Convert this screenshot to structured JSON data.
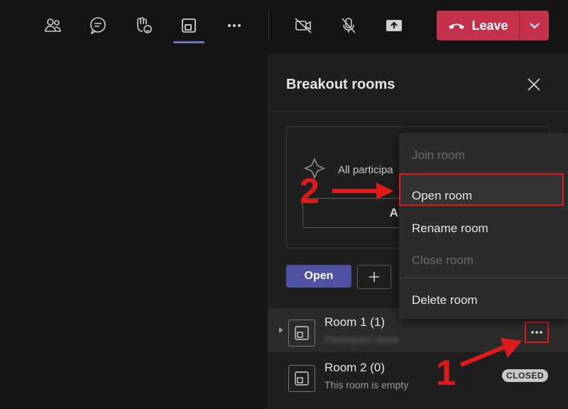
{
  "toolbar": {
    "buttons": [
      {
        "icon": "people-icon"
      },
      {
        "icon": "chat-icon"
      },
      {
        "icon": "reactions-icon"
      },
      {
        "icon": "breakout-rooms-icon"
      },
      {
        "icon": "more-icon"
      },
      {
        "icon": "camera-off-icon"
      },
      {
        "icon": "mic-off-icon"
      },
      {
        "icon": "share-screen-icon"
      }
    ],
    "leave_label": "Leave",
    "leave_color": "#c4314b"
  },
  "panel": {
    "title": "Breakout rooms",
    "card_text": "All participa",
    "assign_label": "Assign",
    "open_label": "Open",
    "accent": "#4f52a2"
  },
  "rooms": [
    {
      "name": "Room 1 (1)",
      "subtitle": "Participant name",
      "state": "selected"
    },
    {
      "name": "Room 2 (0)",
      "subtitle": "This room is empty",
      "status": "CLOSED"
    }
  ],
  "context_menu": {
    "items": [
      {
        "label": "Join room",
        "enabled": false
      },
      {
        "label": "Open room",
        "enabled": true,
        "highlighted": true
      },
      {
        "label": "Rename room",
        "enabled": true
      },
      {
        "label": "Close room",
        "enabled": false
      },
      {
        "label": "Delete room",
        "enabled": true
      }
    ]
  },
  "annotations": {
    "step1": "1",
    "step2": "2",
    "color": "#e0191c"
  }
}
